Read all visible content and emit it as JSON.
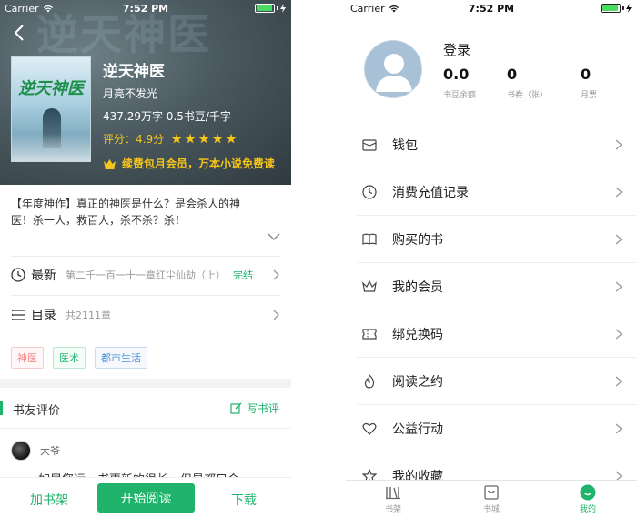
{
  "status_bar": {
    "carrier": "Carrier",
    "time": "7:52 PM"
  },
  "book": {
    "cover_title": "逆天神医",
    "title": "逆天神医",
    "author": "月亮不发光",
    "stats": "437.29万字 0.5书豆/千字",
    "rating_label": "评分：4.9分",
    "rating_value": 4.9,
    "stars": 5,
    "promo": "续费包月会员，万本小说免费读",
    "intro": "【年度神作】真正的神医是什么？是会杀人的神医！杀一人，救百人，杀不杀？杀！",
    "latest": {
      "label": "最新",
      "chapter": "第二千一百一十一章红尘仙劫（上）",
      "status": "完结"
    },
    "toc": {
      "label": "目录",
      "count": "共2111章"
    },
    "tags": [
      "神医",
      "医术",
      "都市生活"
    ],
    "reviews": {
      "title": "书友评价",
      "write_label": "写书评",
      "first": {
        "user": "大爷",
        "text_partial": "如果您运，书更新的很长，但是都只会"
      }
    },
    "actions": {
      "add_shelf": "加书架",
      "start_read": "开始阅读",
      "download": "下载"
    }
  },
  "profile": {
    "login_label": "登录",
    "stats": [
      {
        "value": "0.0",
        "label": "书豆余额"
      },
      {
        "value": "0",
        "label": "书券（张）"
      },
      {
        "value": "0",
        "label": "月票"
      }
    ],
    "menu": [
      {
        "label": "钱包",
        "icon": "wallet-icon"
      },
      {
        "label": "消费充值记录",
        "icon": "clock-icon"
      },
      {
        "label": "购买的书",
        "icon": "book-icon"
      },
      {
        "label": "我的会员",
        "icon": "crown-icon"
      },
      {
        "label": "绑兑换码",
        "icon": "ticket-icon"
      },
      {
        "label": "阅读之约",
        "icon": "flame-icon"
      },
      {
        "label": "公益行动",
        "icon": "heart-icon"
      },
      {
        "label": "我的收藏",
        "icon": "star-icon"
      }
    ],
    "tabs": [
      {
        "label": "书架",
        "icon": "bookshelf-icon",
        "active": false
      },
      {
        "label": "书城",
        "icon": "bookstore-icon",
        "active": false
      },
      {
        "label": "我的",
        "icon": "profile-icon",
        "active": true
      }
    ]
  },
  "colors": {
    "accent": "#1fb36b",
    "gold": "#f5c518"
  }
}
